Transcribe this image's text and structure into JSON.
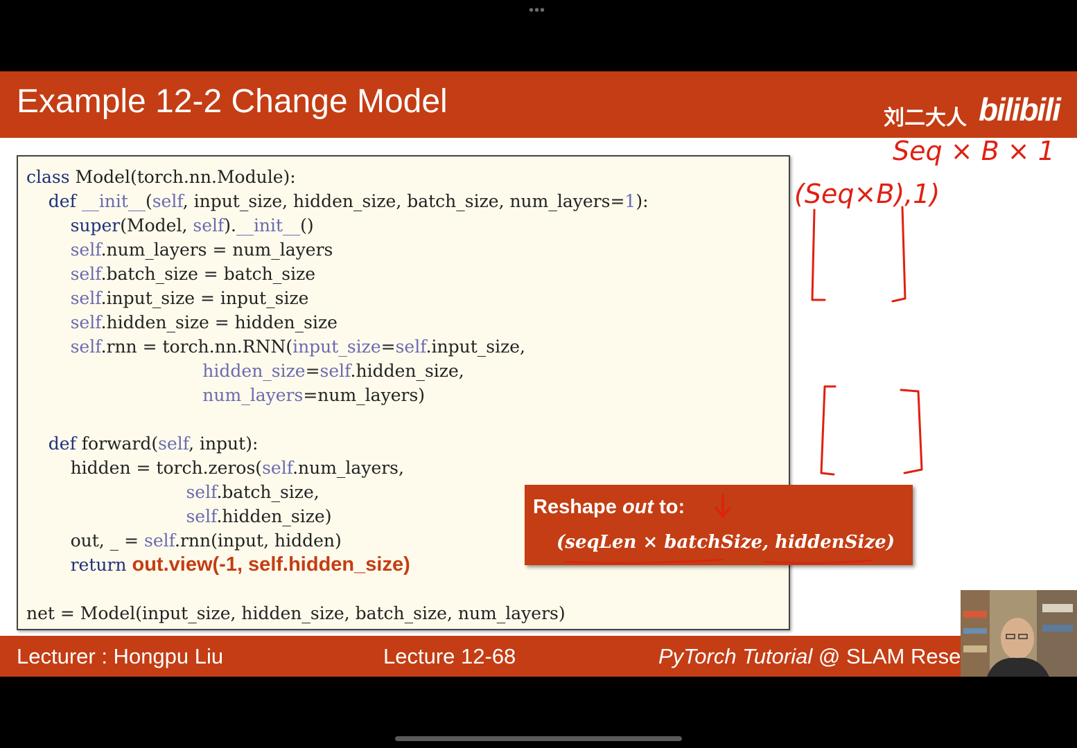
{
  "slide": {
    "title": "Example 12-2 Change Model",
    "brand_cn": "刘二大人",
    "brand_logo": "bilibili"
  },
  "code": {
    "lines": [
      "class Model(torch.nn.Module):",
      "    def __init__(self, input_size, hidden_size, batch_size, num_layers=1):",
      "        super(Model, self).__init__()",
      "        self.num_layers = num_layers",
      "        self.batch_size = batch_size",
      "        self.input_size = input_size",
      "        self.hidden_size = hidden_size",
      "        self.rnn = torch.nn.RNN(input_size=self.input_size,",
      "                                hidden_size=self.hidden_size,",
      "                                num_layers=num_layers)",
      "",
      "    def forward(self, input):",
      "        hidden = torch.zeros(self.num_layers,",
      "                             self.batch_size,",
      "                             self.hidden_size)",
      "        out, _ = self.rnn(input, hidden)",
      "        return",
      "",
      "net = Model(input_size, hidden_size, batch_size, num_layers)"
    ],
    "return_expr": "out.view(-1, self.hidden_size)"
  },
  "callout": {
    "prefix": "Reshape ",
    "var": "out",
    "suffix": " to:",
    "formula": "(seqLen × batchSize, hiddenSize)"
  },
  "annotations": {
    "top": "Seq × B × 1",
    "second": "(Seq×B),1)"
  },
  "footer": {
    "lecturer": "Lecturer : Hongpu Liu",
    "lecture": "Lecture 12-68",
    "course_italic": "PyTorch Tutorial",
    "course_rest": " @ SLAM Resea"
  },
  "colors": {
    "accent": "#c43d14",
    "code_bg": "#fefbec",
    "ink": "#e01f10"
  },
  "icons": {
    "menu": "more-dots-icon",
    "handle": "home-indicator"
  }
}
